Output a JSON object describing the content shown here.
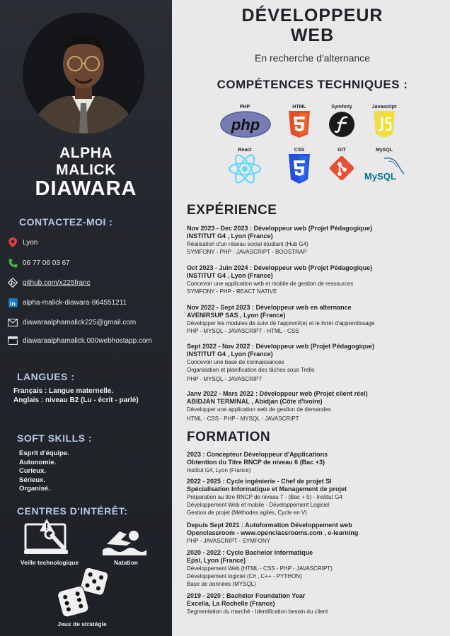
{
  "profile": {
    "first_name": "ALPHA",
    "middle_name": "MALICK",
    "last_name": "DIAWARA"
  },
  "contact": {
    "heading": "CONTACTEZ-MOI :",
    "items": [
      {
        "icon": "location-pin-icon",
        "text": "Lyon"
      },
      {
        "icon": "phone-icon",
        "text": "06 77 06 03 67"
      },
      {
        "icon": "git-icon",
        "text": "github.com/x225franc"
      },
      {
        "icon": "linkedin-icon",
        "text": "alpha-malick-diawara-864551211"
      },
      {
        "icon": "email-icon",
        "text": "diawaraalphamalick225@gmail.com"
      },
      {
        "icon": "website-icon",
        "text": "diawaraalphamalick.000webhostapp.com"
      }
    ]
  },
  "languages": {
    "heading": "LANGUES :",
    "items": [
      "Français : Langue maternelle.",
      "Anglais : niveau B2 (Lu - écrit - parlé)"
    ]
  },
  "soft_skills": {
    "heading": "SOFT SKILLS :",
    "items": [
      "Esprit d'équipe.",
      "Autonomie.",
      "Curieux.",
      "Sérieux.",
      "Organisé."
    ]
  },
  "interests": {
    "heading": "CENTRES D'INTÉRÊT:",
    "items": [
      "Veille technologique",
      "Natation",
      "Jeux de stratégie"
    ]
  },
  "header": {
    "title_line1": "DÉVELOPPEUR",
    "title_line2": "WEB",
    "subtitle": "En recherche d'alternance"
  },
  "skills": {
    "heading": "COMPÉTENCES TECHNIQUES :",
    "items": [
      "PHP",
      "HTML",
      "Symfony",
      "Javascript",
      "React",
      "CSS",
      "GIT",
      "MySQL"
    ],
    "logo_text": {
      "php": "php",
      "mysql": "MySQL"
    }
  },
  "experience": {
    "heading": "EXPÉRIENCE",
    "items": [
      {
        "title": "Nov 2023 - Dec 2023 : Développeur web (Projet Pédagogique)",
        "org": "INSTITUT G4 , Lyon (France)",
        "lines": [
          "Réalisation d'un réseau social étudiant (Hub G4)",
          "SYMFONY - PHP - JAVASCRIPT - BOOSTRAP"
        ]
      },
      {
        "title": "Oct 2023 - Juin 2024 : Développeur web (Projet Pédagogique)",
        "org": "INSTITUT G4 , Lyon (France)",
        "lines": [
          "Concevoir une application web et mobile de gestion de ressources",
          "SYMFONY - PHP - REACT NATIVE"
        ]
      },
      {
        "title": "Nov 2022 - Sept 2023 : Développeur web en alternance",
        "org": "AVENIRSUP SAS , Lyon (France)",
        "lines": [
          "Développer les modules de suivi de l'apprenti(e) et le livret d'apprentissage",
          "PHP - MYSQL - JAVASCRIPT - HTML - CSS"
        ]
      },
      {
        "title": "Sept 2022 - Nov 2022 : Développeur web (Projet Pédagogique)",
        "org": "INSTITUT G4 , Lyon (France)",
        "lines": [
          "Concevoir une base de connaissances",
          "Organisation et planification des tâches sous Trello",
          "PHP - MYSQL - JAVASCRIPT"
        ]
      },
      {
        "title": "Janv 2022 - Mars 2022 : Développeur web (Projet client réel)",
        "org": "ABIDJAN TERMINAL , Abidjan (Côte d'ivoire)",
        "lines": [
          "Développer une application web de gestion de demandes",
          "HTML - CSS - PHP -  MYSQL - JAVASCRIPT"
        ]
      }
    ]
  },
  "education": {
    "heading": "FORMATION",
    "items": [
      {
        "title": "2023 : Concepteur Développeur d'Applications",
        "org": "Obtention du Titre RNCP de niveau 6 (Bac +3)",
        "lines": [
          "Institut G4, Lyon (France)"
        ]
      },
      {
        "title": "2022 - 2025 : Cycle ingénierie - Chef de projet SI",
        "org": "Spécialisation Informatique et Management de projet",
        "lines": [
          "Préparation au titre RNCP de niveau 7 - (Bac + 5) - Institut G4",
          "Développement Web et mobile - Développement Logiciel",
          "Gestion de projet (Méthodes agiles, Cycle en V)"
        ]
      },
      {
        "title": "Depuis Sept 2021 : Autoformation Développement web",
        "org": "Openclassroom - www.openclassrooms.com , e-learning",
        "lines": [
          "PHP - JAVASCRIPT - SYMFONY"
        ]
      },
      {
        "title": "2020 - 2022 : Cycle Bachelor Informatique",
        "org": "Epsi, Lyon (France)",
        "lines": [
          "Développement Web (HTML - CSS - PHP - JAVASCRIPT)",
          "Développement logiciel (C# , C++ - PYTHON)",
          "Base de données (MYSQL)"
        ]
      },
      {
        "title": "2019 - 2020 : Bachelor Foundation Year",
        "org": "Excelia, La Rochelle (France)",
        "lines": [
          "Segmentation du marché - Identification besoin du client"
        ]
      }
    ]
  },
  "colors": {
    "sidebar": "#23262c",
    "accent": "#b9c9e6",
    "php": "#787cb5",
    "html": "#e44d26",
    "css": "#264de4",
    "js": "#f0db4f",
    "git": "#e84e31",
    "react": "#61dafb"
  }
}
